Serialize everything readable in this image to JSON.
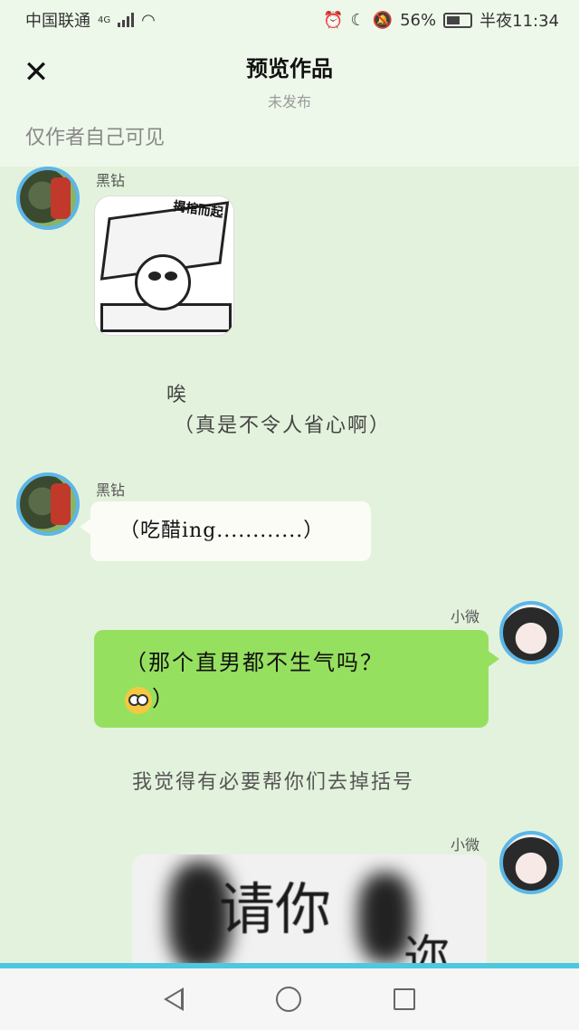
{
  "status_bar": {
    "carrier": "中国联通",
    "network": "4G",
    "battery": "56%",
    "time": "半夜11:34"
  },
  "header": {
    "close_icon": "close-icon",
    "title": "预览作品",
    "subtitle": "未发布"
  },
  "notice": "仅作者自己可见",
  "messages": [
    {
      "sender": "黑钻",
      "type": "sticker",
      "sticker_text": "揭棺而起"
    },
    {
      "type": "narration",
      "lines": [
        "唉",
        "（真是不令人省心啊）"
      ]
    },
    {
      "sender": "黑钻",
      "type": "text",
      "text": "（吃醋ing............）"
    },
    {
      "sender": "小微",
      "type": "text",
      "lines": [
        "（那个直男都不生气吗？",
        "）"
      ],
      "emoji": "flushed-face-emoji"
    },
    {
      "type": "narration",
      "text": "我觉得有必要帮你们去掉括号"
    },
    {
      "sender": "小微",
      "type": "image",
      "image_text_line1": "请你",
      "image_text_line2": "迩"
    }
  ],
  "nav": {
    "back": "back-icon",
    "home": "home-icon",
    "recent": "recent-apps-icon"
  },
  "colors": {
    "chat_bg": "#e3f2dc",
    "bubble_green": "#96e05f",
    "bubble_white": "#fbfcf6",
    "avatar_ring": "#5cb6e8"
  }
}
